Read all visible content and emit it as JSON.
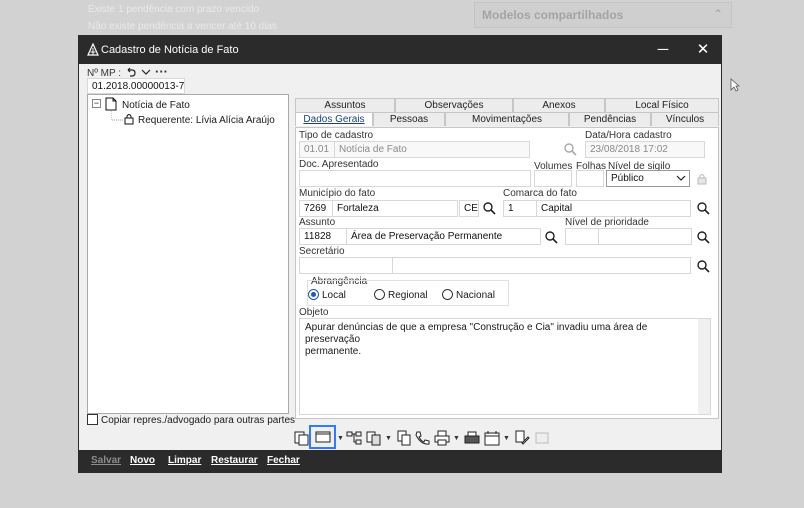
{
  "background": {
    "line1": "Existe 1 pendência com prazo vencido",
    "line2": "Não existe pendência a vencer até 10 dias",
    "panel_title": "Modelos compartilhados"
  },
  "dialog": {
    "title": "Cadastro de Notícia de Fato",
    "minimize": "─",
    "close": "✕",
    "mp_label": "Nº MP :",
    "mp_value": "01.2018.00000013-7",
    "tree": {
      "root": "Notícia de Fato",
      "child": "Requerente: Lívia Alícia Araújo",
      "expander": "−"
    },
    "tabs_row1": [
      "Assuntos",
      "Observações",
      "Anexos",
      "Local Físico"
    ],
    "tabs_row2": [
      "Dados Gerais",
      "Pessoas",
      "Movimentações",
      "Pendências",
      "Vínculos"
    ],
    "form": {
      "tipo_label": "Tipo de cadastro",
      "tipo_code": "01.01",
      "tipo_value": "Notícia de Fato",
      "datahora_label": "Data/Hora cadastro",
      "datahora_value": "23/08/2018 17:02",
      "doc_label": "Doc. Apresentado",
      "volumes_label": "Volumes",
      "folhas_label": "Folhas",
      "sigilo_label": "Nível de sigilo",
      "sigilo_value": "Público",
      "municipio_label": "Município do fato",
      "municipio_code": "7269",
      "municipio_value": "Fortaleza",
      "uf_value": "CE",
      "comarca_label": "Comarca do fato",
      "comarca_code": "1",
      "comarca_value": "Capital",
      "assunto_label": "Assunto",
      "assunto_code": "11828",
      "assunto_value": "Área de Preservação Permanente",
      "prioridade_label": "Nível de prioridade",
      "secretario_label": "Secretário",
      "abrangencia_label": "Abrangência",
      "radio_local": "Local",
      "radio_regional": "Regional",
      "radio_nacional": "Nacional",
      "objeto_label": "Objeto",
      "objeto_line1": "Apurar denúncias de que a empresa \"Construção e Cia\" invadiu uma área de preservação",
      "objeto_line2": "permanente."
    },
    "copy_label": "Copiar repres./advogado para outras partes",
    "buttons": {
      "salvar": "Salvar",
      "novo": "Novo",
      "limpar": "Limpar",
      "restaurar": "Restaurar",
      "fechar": "Fechar"
    }
  },
  "colors": {
    "titlebar": "#2b2b2b",
    "accent": "#1a56c9",
    "highlight": "#2f7bff"
  }
}
